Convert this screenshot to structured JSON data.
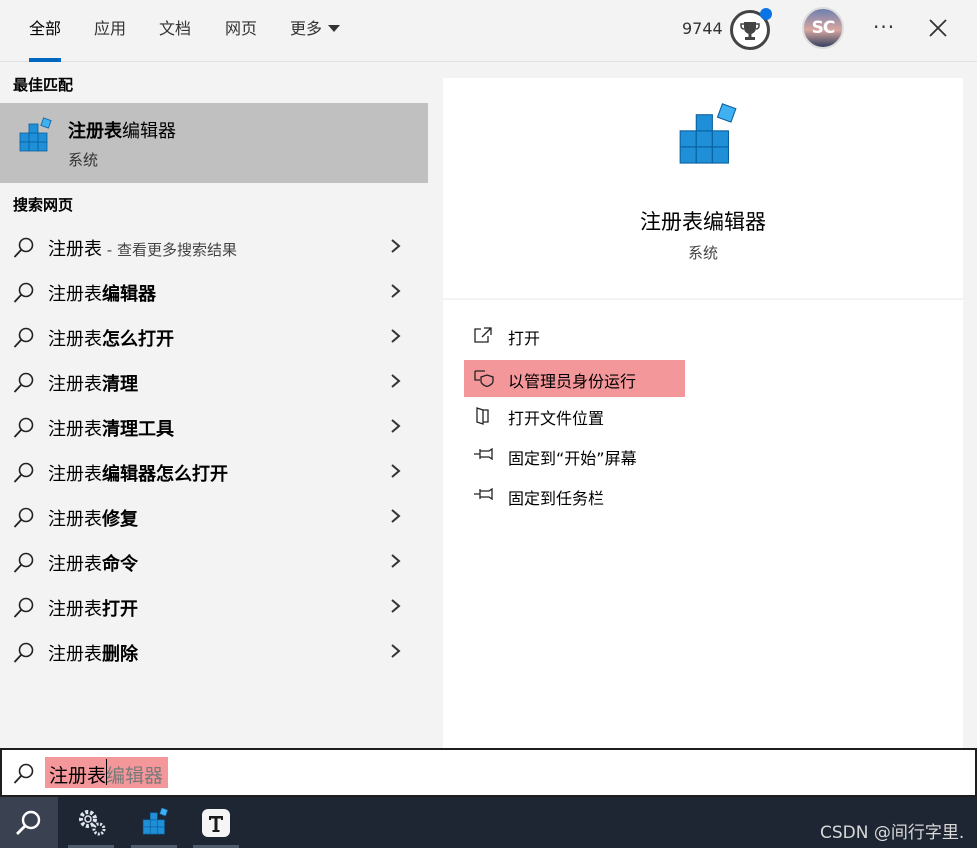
{
  "tabs": [
    {
      "label": "全部",
      "active": true
    },
    {
      "label": "应用",
      "active": false
    },
    {
      "label": "文档",
      "active": false
    },
    {
      "label": "网页",
      "active": false
    },
    {
      "label": "更多",
      "active": false
    }
  ],
  "header": {
    "points": "9744",
    "avatar_initials": "SC",
    "more_glyph": "···",
    "accent_color": "#0067c0"
  },
  "best_match": {
    "section_label": "最佳匹配",
    "title_bold": "注册表",
    "title_rest": "编辑器",
    "subtitle": "系统",
    "icon": "registry-editor-icon"
  },
  "web_search": {
    "section_label": "搜索网页",
    "items": [
      {
        "prefix": "注册表",
        "bold": "",
        "hint": " - 查看更多搜索结果"
      },
      {
        "prefix": "注册表",
        "bold": "编辑器",
        "hint": ""
      },
      {
        "prefix": "注册表",
        "bold": "怎么打开",
        "hint": ""
      },
      {
        "prefix": "注册表",
        "bold": "清理",
        "hint": ""
      },
      {
        "prefix": "注册表",
        "bold": "清理工具",
        "hint": ""
      },
      {
        "prefix": "注册表",
        "bold": "编辑器怎么打开",
        "hint": ""
      },
      {
        "prefix": "注册表",
        "bold": "修复",
        "hint": ""
      },
      {
        "prefix": "注册表",
        "bold": "命令",
        "hint": ""
      },
      {
        "prefix": "注册表",
        "bold": "打开",
        "hint": ""
      },
      {
        "prefix": "注册表",
        "bold": "删除",
        "hint": ""
      }
    ]
  },
  "detail": {
    "title": "注册表编辑器",
    "subtitle": "系统"
  },
  "actions": [
    {
      "label": "打开",
      "icon": "open-icon",
      "highlighted": false
    },
    {
      "label": "以管理员身份运行",
      "icon": "shield-icon",
      "highlighted": true
    },
    {
      "label": "打开文件位置",
      "icon": "file-location-icon",
      "highlighted": false
    },
    {
      "label": "固定到“开始”屏幕",
      "icon": "pin-icon",
      "highlighted": false
    },
    {
      "label": "固定到任务栏",
      "icon": "pin-icon",
      "highlighted": false
    }
  ],
  "search": {
    "typed": "注册表",
    "suggestion": "编辑器",
    "highlight_color": "#f4979a"
  },
  "taskbar": {
    "apps": [
      "settings-icon",
      "registry-editor-icon",
      "typora-icon"
    ],
    "watermark": "CSDN @间行字里."
  }
}
